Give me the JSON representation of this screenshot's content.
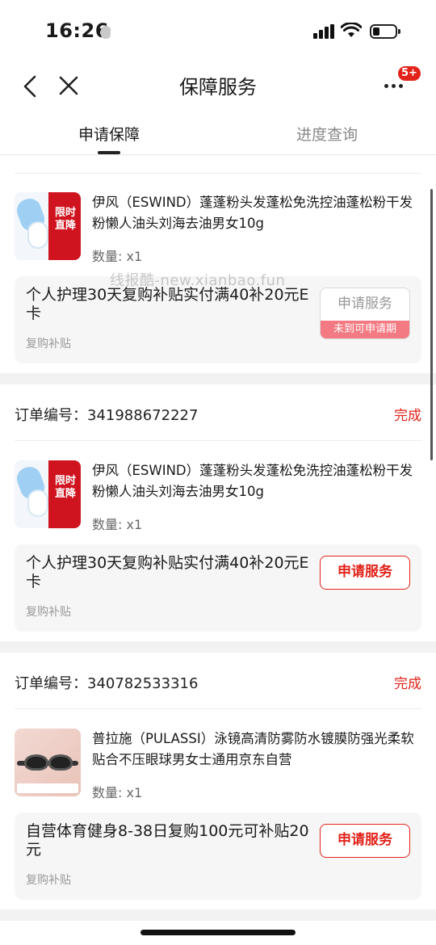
{
  "status_bar": {
    "time": "16:26"
  },
  "nav": {
    "title": "保障服务",
    "badge": "5+"
  },
  "tabs": [
    {
      "label": "申请保障"
    },
    {
      "label": "进度查询"
    }
  ],
  "watermark": "线报酷-new.xianbao.fun",
  "orders": [
    {
      "product": {
        "thumb_text": "限时直降",
        "title": "伊风（ESWIND）蓬蓬粉头发蓬松免洗控油蓬松粉干发粉懒人油头刘海去油男女10g",
        "qty": "数量: x1"
      },
      "service": {
        "title": "个人护理30天复购补贴实付满40补20元E 卡",
        "subtitle": "复购补贴",
        "button": "申请服务",
        "disabled_note": "未到可申请期"
      }
    },
    {
      "order_label": "订单编号：341988672227",
      "status": "完成",
      "product": {
        "thumb_text": "限时直降",
        "title": "伊风（ESWIND）蓬蓬粉头发蓬松免洗控油蓬松粉干发粉懒人油头刘海去油男女10g",
        "qty": "数量: x1"
      },
      "service": {
        "title": "个人护理30天复购补贴实付满40补20元E 卡",
        "subtitle": "复购补贴",
        "button": "申请服务"
      }
    },
    {
      "order_label": "订单编号：340782533316",
      "status": "完成",
      "product": {
        "title": "普拉施（PULASSI）泳镜高清防雾防水镀膜防强光柔软贴合不压眼球男女士通用京东自营",
        "qty": "数量: x1"
      },
      "service": {
        "title": "自营体育健身8-38日复购100元可补贴20元",
        "subtitle": "复购补贴",
        "button": "申请服务"
      }
    }
  ]
}
